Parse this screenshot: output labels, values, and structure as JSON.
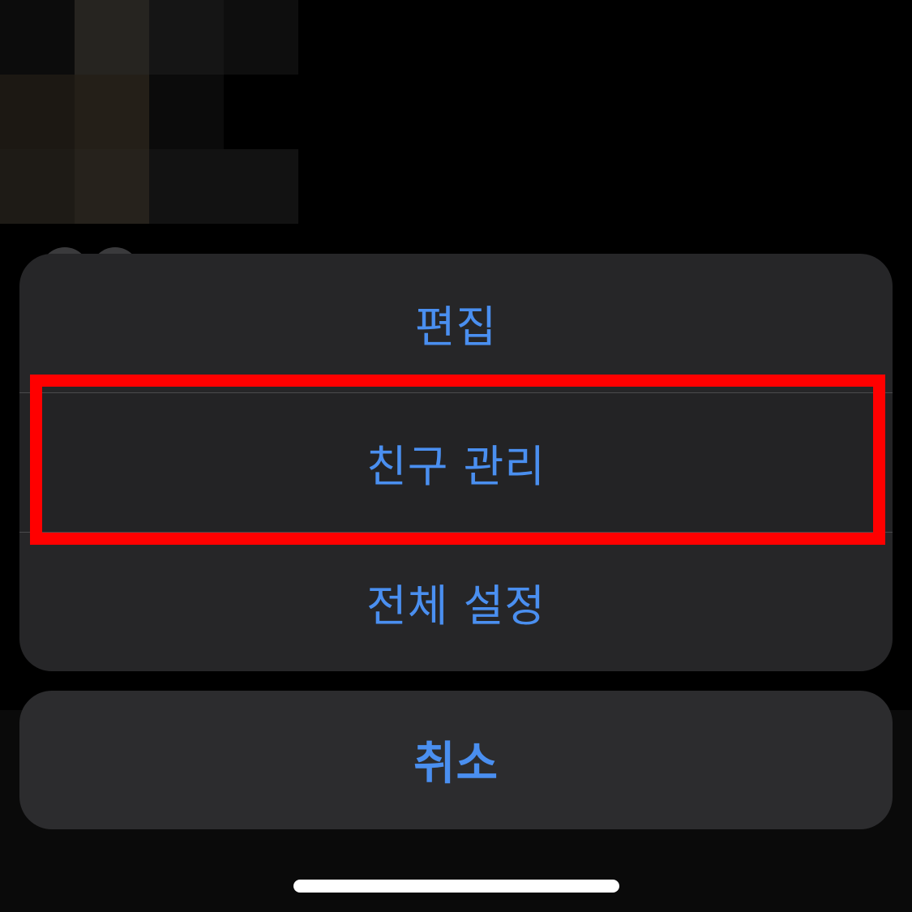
{
  "action_sheet": {
    "items": [
      {
        "label": "편집"
      },
      {
        "label": "친구 관리"
      },
      {
        "label": "전체 설정"
      }
    ],
    "cancel_label": "취소"
  },
  "highlight": {
    "target": "친구 관리",
    "color": "#ff0000"
  },
  "colors": {
    "accent": "#4a8ff0",
    "sheet_background": "#262628",
    "cancel_background": "#2c2c2e"
  }
}
